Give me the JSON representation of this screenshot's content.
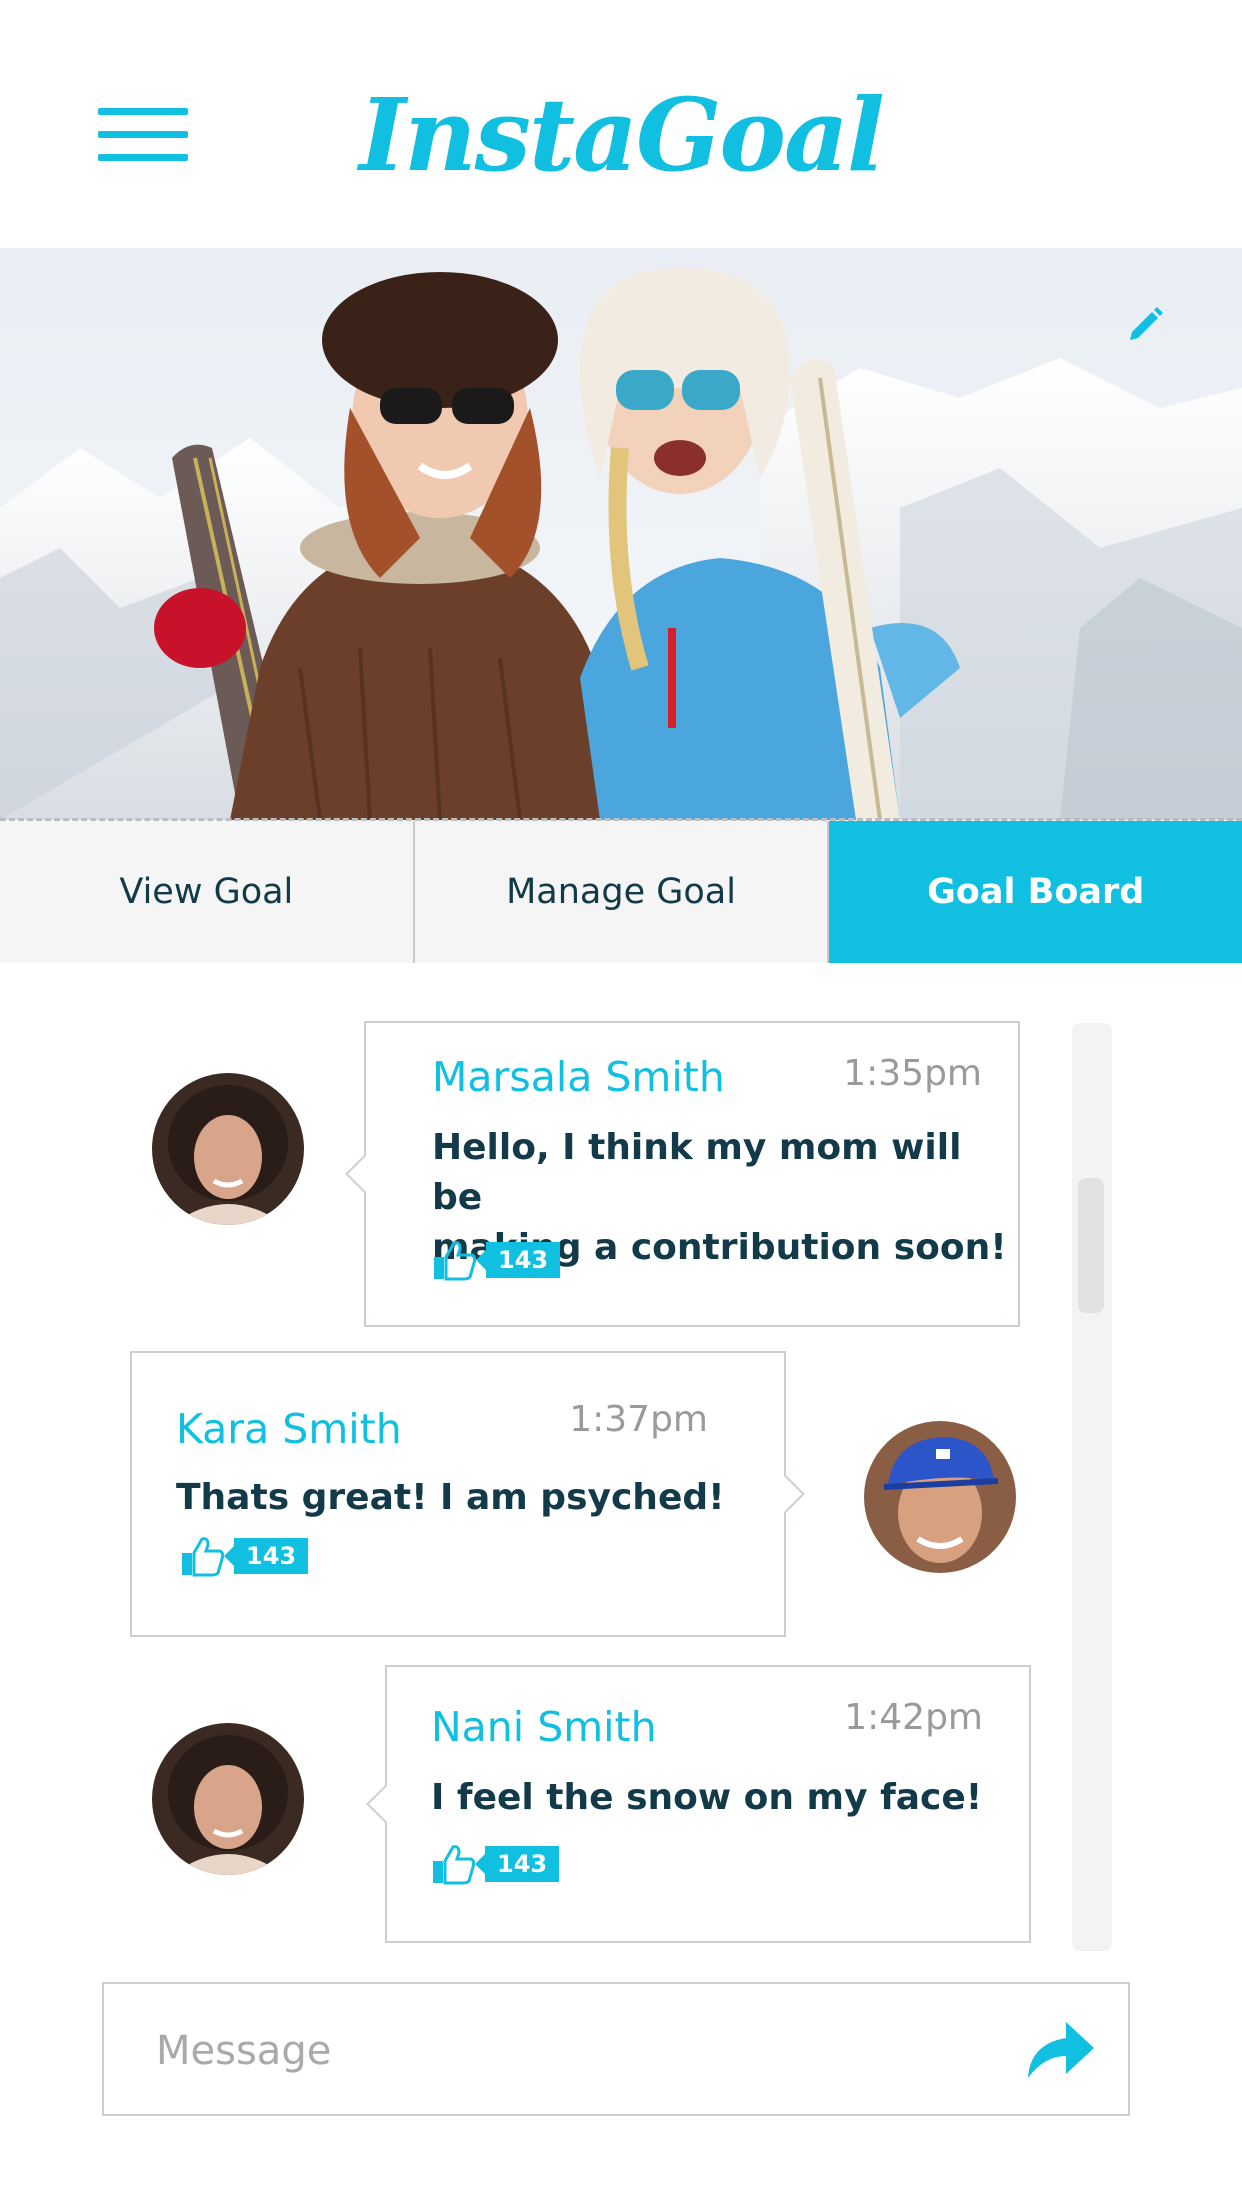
{
  "header": {
    "logo": "InstaGoal"
  },
  "tabs": [
    {
      "label": "View Goal"
    },
    {
      "label": "Manage Goal"
    },
    {
      "label": "Goal Board",
      "active": true
    }
  ],
  "messages": [
    {
      "sender": "Marsala Smith",
      "time": "1:35pm",
      "text_line1": "Hello, I think my mom will be",
      "text_line2": "making a contribution soon!",
      "likes": "143"
    },
    {
      "sender": "Kara Smith",
      "time": "1:37pm",
      "text_line1": "Thats great! I am psyched!",
      "likes": "143"
    },
    {
      "sender": "Nani Smith",
      "time": "1:42pm",
      "text_line1": "I feel the snow on my face!",
      "likes": "143"
    }
  ],
  "composer": {
    "placeholder": "Message"
  },
  "colors": {
    "accent": "#11bfe1",
    "text": "#123a49",
    "muted": "#9a9a9a",
    "border": "#c9cfd3"
  },
  "icons": {
    "menu": "hamburger-icon",
    "edit": "pencil-icon",
    "like": "thumbs-up-icon",
    "send": "share-arrow-icon"
  }
}
